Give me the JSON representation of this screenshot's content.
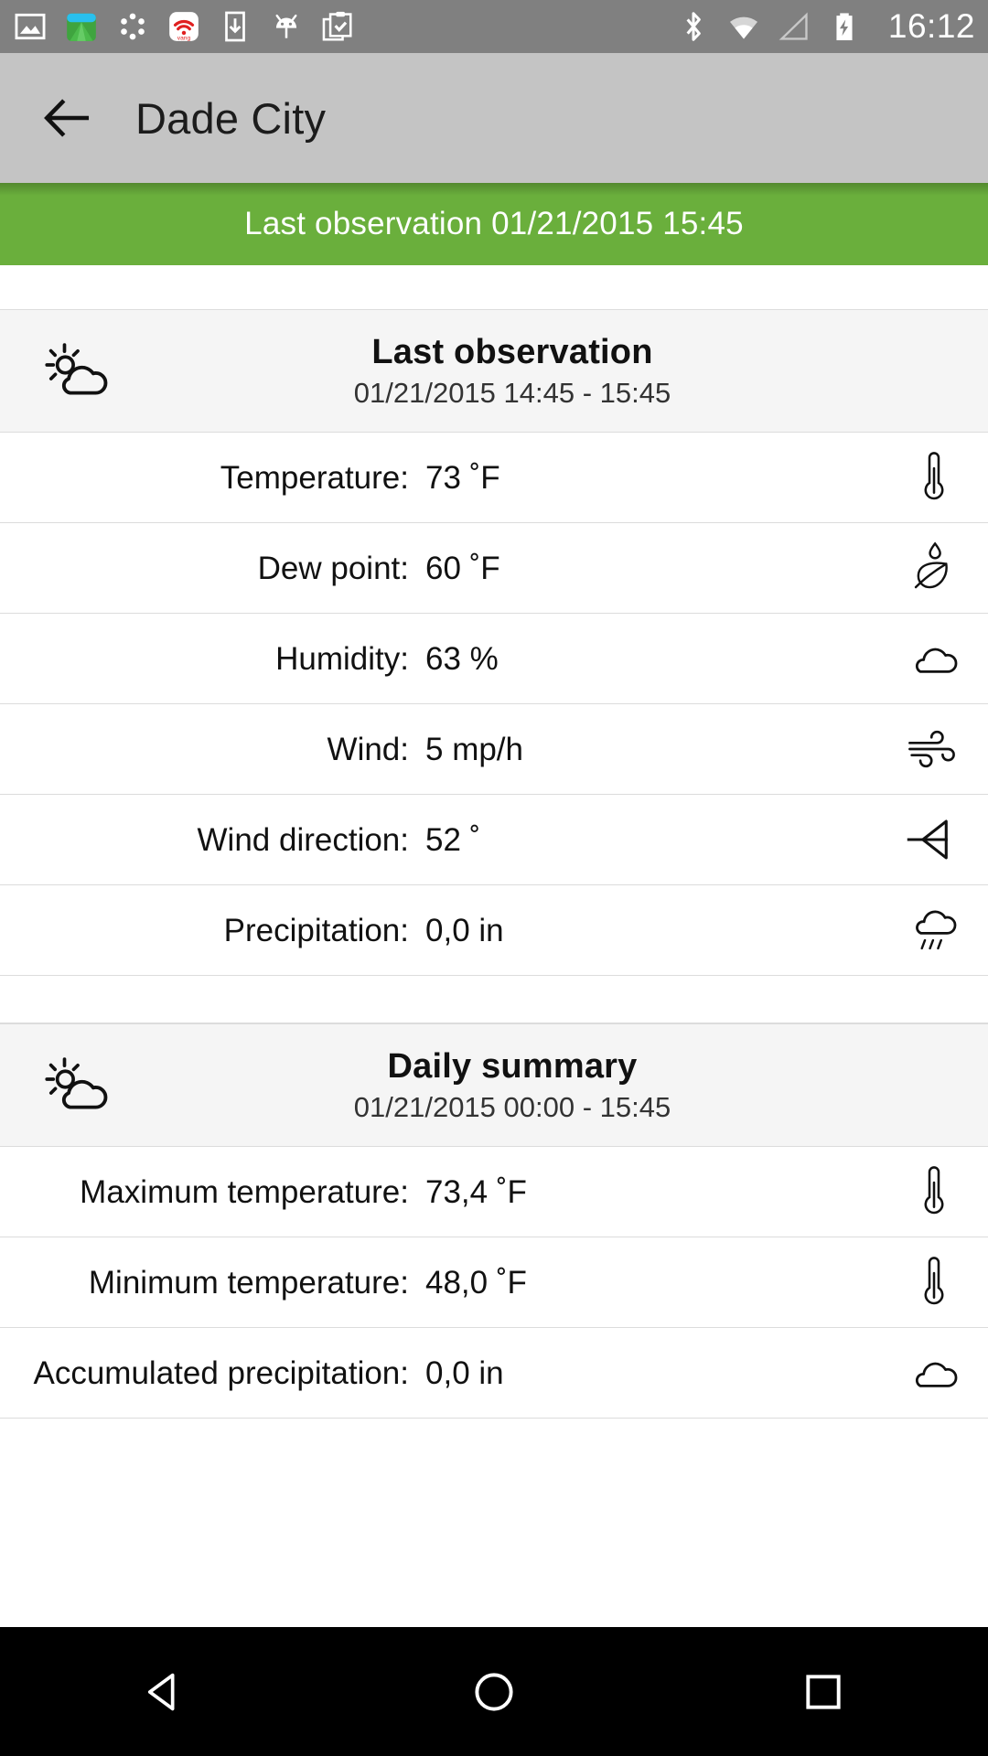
{
  "statusbar": {
    "time": "16:12",
    "left_icons": [
      "gallery-icon",
      "app-green-icon",
      "dots-loading-icon",
      "vang-fm-icon",
      "download-icon",
      "android-icon",
      "tasks-icon"
    ],
    "right_icons": [
      "bluetooth-icon",
      "wifi-icon",
      "cell-signal-icon",
      "battery-charging-icon"
    ]
  },
  "appbar": {
    "back_label": "back-arrow",
    "title": "Dade City"
  },
  "banner": {
    "text": "Last observation 01/21/2015 15:45",
    "color": "#6aaf3c"
  },
  "sections": [
    {
      "icon": "sun-cloud-icon",
      "title": "Last observation",
      "subtitle": "01/21/2015 14:45 - 15:45",
      "rows": [
        {
          "label": "Temperature:",
          "value": "73 ˚F",
          "icon": "thermometer-icon"
        },
        {
          "label": "Dew point:",
          "value": "60 ˚F",
          "icon": "leaf-drop-icon"
        },
        {
          "label": "Humidity:",
          "value": "63 %",
          "icon": "cloud-icon"
        },
        {
          "label": "Wind:",
          "value": "5 mp/h",
          "icon": "wind-icon"
        },
        {
          "label": "Wind direction:",
          "value": "52 ˚",
          "icon": "wind-direction-icon"
        },
        {
          "label": "Precipitation:",
          "value": "0,0 in",
          "icon": "rain-cloud-icon"
        }
      ]
    },
    {
      "icon": "sun-cloud-icon",
      "title": "Daily summary",
      "subtitle": "01/21/2015 00:00 - 15:45",
      "rows": [
        {
          "label": "Maximum temperature:",
          "value": "73,4 ˚F",
          "icon": "thermometer-icon"
        },
        {
          "label": "Minimum temperature:",
          "value": "48,0 ˚F",
          "icon": "thermometer-icon"
        },
        {
          "label": "Accumulated precipitation:",
          "value": "0,0 in",
          "icon": "cloud-icon"
        }
      ]
    }
  ],
  "navbar": {
    "back": "nav-back-triangle",
    "home": "nav-home-circle",
    "recents": "nav-recents-square"
  }
}
